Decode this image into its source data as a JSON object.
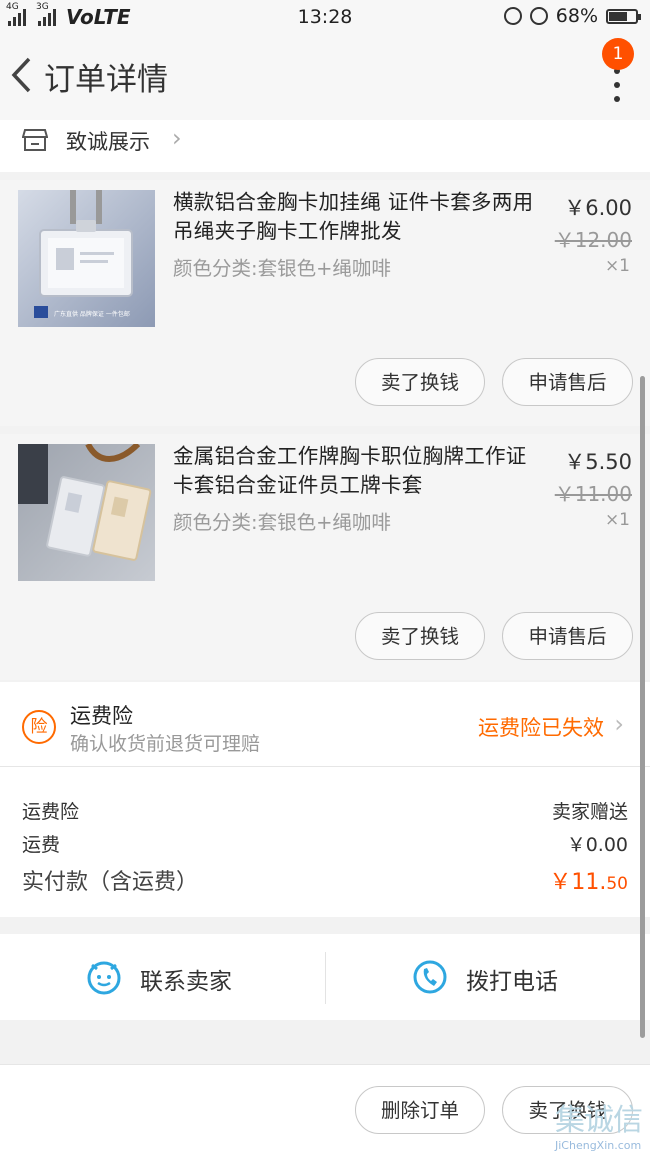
{
  "status_bar": {
    "network_a": "4G",
    "network_b": "3G",
    "volte": "VoLTE",
    "time": "13:28",
    "battery": "68%",
    "battery_level": 0.68
  },
  "nav": {
    "title": "订单详情",
    "badge_count": "1"
  },
  "shop": {
    "name": "致诚展示"
  },
  "items": [
    {
      "title": "横款铝合金胸卡加挂绳 证件卡套多两用吊绳夹子胸卡工作牌批发",
      "sku": "颜色分类:套银色+绳咖啡",
      "price": "￥6.00",
      "original_price": "￥12.00",
      "qty": "×1",
      "thumb_caption": "广东直供 品牌保证 一件包邮",
      "btn_sell": "卖了换钱",
      "btn_after_sale": "申请售后"
    },
    {
      "title": "金属铝合金工作牌胸卡职位胸牌工作证卡套铝合金证件员工牌卡套",
      "sku": "颜色分类:套银色+绳咖啡",
      "price": "￥5.50",
      "original_price": "￥11.00",
      "qty": "×1",
      "btn_sell": "卖了换钱",
      "btn_after_sale": "申请售后"
    }
  ],
  "insurance": {
    "icon_text": "险",
    "title": "运费险",
    "subtitle": "确认收货前退货可理赔",
    "status": "运费险已失效"
  },
  "summary": {
    "ins_label": "运费险",
    "ins_value": "卖家赠送",
    "shipping_label": "运费",
    "shipping_value": "￥0.00",
    "total_label": "实付款（含运费）",
    "total_main": "￥11.",
    "total_cents": "50"
  },
  "contact": {
    "seller": "联系卖家",
    "call": "拨打电话"
  },
  "bottom": {
    "delete": "删除订单",
    "sell": "卖了换钱"
  },
  "watermark": {
    "cn": "集诚信",
    "en": "JiChengXin.com"
  },
  "colors": {
    "accent": "#ff5000",
    "insurance": "#ff6a00",
    "contact_icon": "#2ea7e0"
  }
}
